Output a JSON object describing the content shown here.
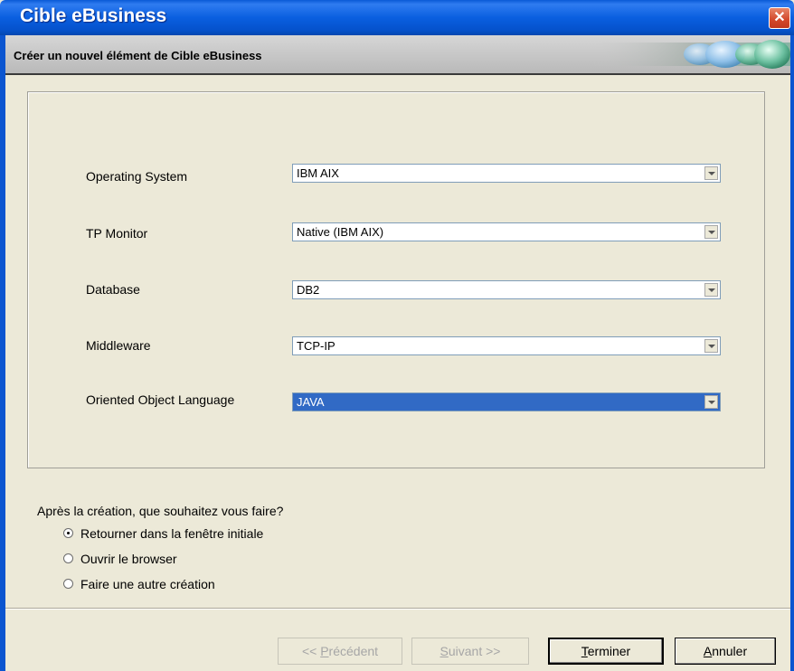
{
  "window": {
    "title": "Cible eBusiness",
    "close_icon": "close-icon"
  },
  "header": {
    "title": "Créer un nouvel élément de Cible eBusiness"
  },
  "form": {
    "fields": [
      {
        "label": "Operating System",
        "value": "IBM AIX"
      },
      {
        "label": "TP Monitor",
        "value": "Native (IBM AIX)"
      },
      {
        "label": "Database",
        "value": "DB2"
      },
      {
        "label": "Middleware",
        "value": "TCP-IP"
      },
      {
        "label": "Oriented Object Language",
        "value": "JAVA"
      }
    ]
  },
  "after_creation": {
    "question": "Après la création, que souhaitez vous faire?",
    "options": [
      {
        "label": "Retourner dans la fenêtre initiale",
        "selected": true
      },
      {
        "label": "Ouvrir le browser",
        "selected": false
      },
      {
        "label": "Faire une autre création",
        "selected": false
      }
    ]
  },
  "buttons": {
    "previous": {
      "prefix": "<< ",
      "mnemonic": "P",
      "rest": "récédent",
      "enabled": false
    },
    "next": {
      "mnemonic": "S",
      "rest": "uivant >>",
      "enabled": false
    },
    "finish": {
      "mnemonic": "T",
      "rest": "erminer",
      "enabled": true
    },
    "cancel": {
      "mnemonic": "A",
      "rest": "nnuler",
      "enabled": true
    }
  },
  "colors": {
    "title_bar": "#0a5fe0",
    "selection": "#316ac5",
    "window_bg": "#ece9d8"
  }
}
